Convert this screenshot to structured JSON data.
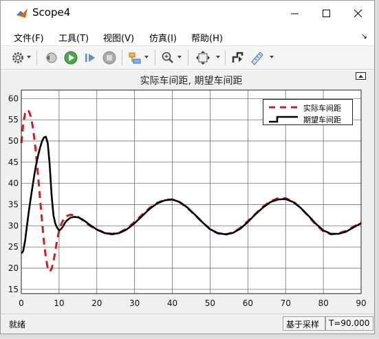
{
  "window": {
    "title": "Scope4"
  },
  "menu": [
    "文件(F)",
    "工具(T)",
    "视图(V)",
    "仿真(I)",
    "帮助(H)"
  ],
  "toolbar": {
    "icons": [
      "gear-icon",
      "restore-layout-icon",
      "run-icon",
      "step-forward-icon",
      "stop-icon",
      "highlight-block-icon",
      "zoom-icon",
      "fit-view-icon",
      "bring-to-front-icon",
      "measure-icon"
    ]
  },
  "plot": {
    "title": "实际车间距, 期望车间距"
  },
  "chart_data": {
    "type": "line",
    "title": "实际车间距, 期望车间距",
    "xlabel": "",
    "ylabel": "",
    "xlim": [
      0,
      90
    ],
    "ylim": [
      14,
      62
    ],
    "xticks": [
      0,
      10,
      20,
      30,
      40,
      50,
      60,
      70,
      80,
      90
    ],
    "yticks": [
      15,
      20,
      25,
      30,
      35,
      40,
      45,
      50,
      55,
      60
    ],
    "grid": true,
    "legend_position": "top-right",
    "series": [
      {
        "name": "实际车间距",
        "color": "#cc1f1f",
        "style": "dashed",
        "x": [
          0,
          0.5,
          1,
          1.5,
          2,
          2.5,
          3,
          3.5,
          4,
          4.5,
          5,
          5.5,
          6,
          6.5,
          7,
          7.5,
          8,
          8.5,
          9,
          9.5,
          10,
          10.5,
          11,
          11.5,
          12,
          13,
          14,
          15,
          16,
          17,
          18,
          20,
          22,
          24,
          26,
          28,
          30,
          32,
          34,
          36,
          38,
          40,
          42,
          44,
          46,
          48,
          50,
          52,
          54,
          56,
          58,
          60,
          62,
          64,
          66,
          68,
          70,
          72,
          74,
          76,
          78,
          80,
          82,
          84,
          86,
          88,
          90
        ],
        "y": [
          49.5,
          54,
          56.5,
          57.3,
          57,
          55.8,
          53.5,
          50.2,
          46,
          41.2,
          36,
          31,
          26.2,
          22.5,
          20,
          19.2,
          19.8,
          21.5,
          24,
          26.7,
          28.8,
          30.2,
          31.2,
          31.9,
          32.3,
          32.6,
          32.5,
          32.1,
          31.5,
          30.8,
          30.1,
          29.1,
          28.4,
          28.1,
          28.4,
          29.4,
          30.9,
          32.6,
          34.2,
          35.4,
          36.1,
          36.2,
          35.5,
          34.2,
          32.5,
          30.8,
          29.2,
          28.2,
          27.9,
          28.4,
          29.5,
          31.1,
          32.8,
          34.5,
          35.8,
          36.5,
          36.5,
          35.7,
          34.2,
          32.3,
          30.3,
          28.7,
          28,
          28.2,
          28.8,
          29.8,
          30.8
        ]
      },
      {
        "name": "期望车间距",
        "color": "#000000",
        "style": "solid",
        "x": [
          0,
          0.5,
          1,
          1.5,
          2,
          2.5,
          3,
          3.5,
          4,
          4.5,
          5,
          5.5,
          6,
          6.5,
          7,
          7.5,
          8,
          8.5,
          9,
          9.5,
          10,
          10.5,
          11,
          11.5,
          12,
          13,
          14,
          15,
          16,
          17,
          18,
          20,
          22,
          24,
          26,
          28,
          30,
          32,
          34,
          36,
          38,
          40,
          42,
          44,
          46,
          48,
          50,
          52,
          54,
          56,
          58,
          60,
          62,
          64,
          66,
          68,
          70,
          72,
          74,
          76,
          78,
          80,
          82,
          84,
          86,
          88,
          90
        ],
        "y": [
          23.5,
          24,
          26.5,
          30,
          33.5,
          36.5,
          39.5,
          42.3,
          44.8,
          46.8,
          48.5,
          50,
          50.8,
          51,
          49.5,
          44.5,
          37.5,
          32.5,
          30.5,
          29.5,
          28.9,
          29.2,
          29.8,
          30.6,
          31.2,
          31.9,
          32.1,
          32,
          31.6,
          31,
          30.3,
          29.1,
          28.3,
          28,
          28.3,
          29.2,
          30.6,
          32.3,
          34,
          35.3,
          36,
          36.2,
          35.6,
          34.3,
          32.6,
          30.8,
          29.2,
          28.3,
          28,
          28.3,
          29.3,
          30.9,
          32.7,
          34.3,
          35.6,
          36.2,
          36.3,
          35.6,
          34.2,
          32.4,
          30.5,
          28.9,
          28.1,
          28.1,
          28.6,
          29.6,
          30.6
        ]
      }
    ]
  },
  "status": {
    "left": "就绪",
    "mode": "基于采样",
    "time": "T=90.000"
  }
}
